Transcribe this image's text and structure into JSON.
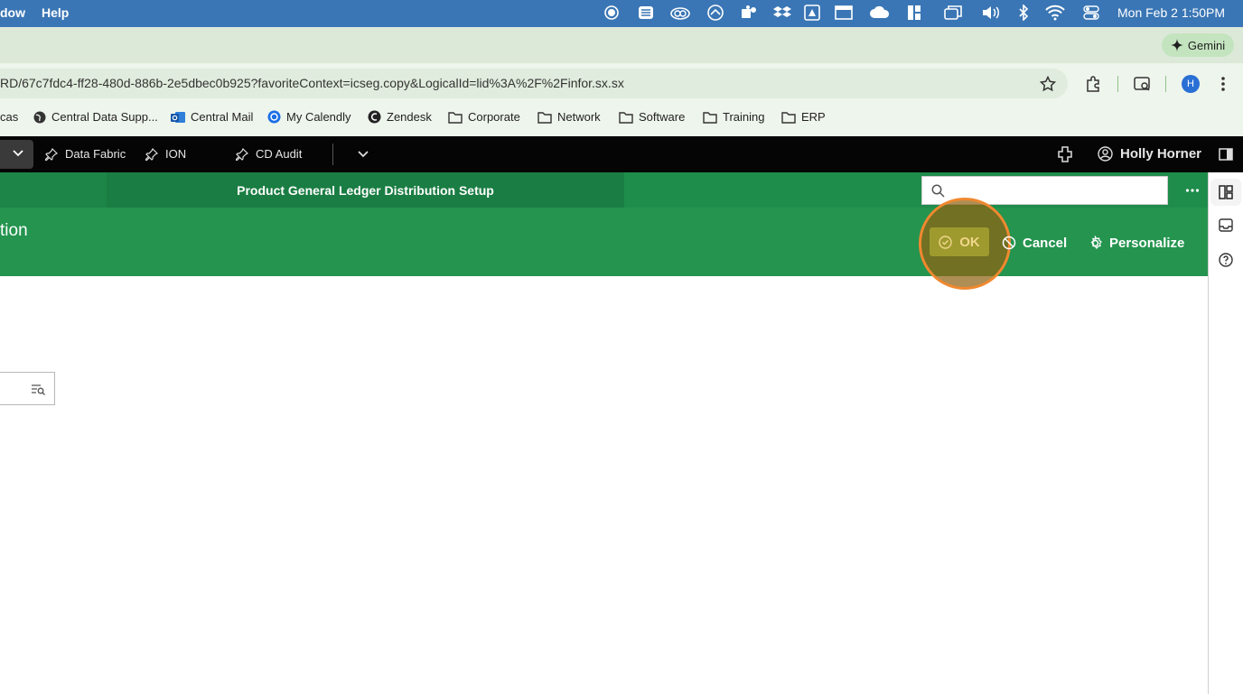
{
  "menubar": {
    "items": [
      "dow",
      "Help"
    ],
    "tray_icons": [
      "record-icon",
      "list-icon",
      "cc-icon",
      "sync-icon",
      "teams-icon",
      "dropbox-icon",
      "drive-icon",
      "window-icon",
      "cloud-icon",
      "panel-icon",
      "screens-icon",
      "volume-icon",
      "bluetooth-icon",
      "wifi-icon",
      "control-center-icon"
    ],
    "clock": "Mon Feb 2  1:50PM"
  },
  "gemini": {
    "label": "Gemini"
  },
  "browser": {
    "url": "RD/67c7fdc4-ff28-480d-886b-2e5dbec0b925?favoriteContext=icseg.copy&LogicalId=lid%3A%2F%2Finfor.sx.sx",
    "profile_initial": "H"
  },
  "bookmarks": [
    {
      "label": "cas",
      "icon": "none"
    },
    {
      "label": "Central Data Supp...",
      "icon": "globe-icon"
    },
    {
      "label": "Central Mail",
      "icon": "outlook-icon"
    },
    {
      "label": "My Calendly",
      "icon": "calendly-icon"
    },
    {
      "label": "Zendesk",
      "icon": "zendesk-icon"
    },
    {
      "label": "Corporate",
      "icon": "folder-icon"
    },
    {
      "label": "Network",
      "icon": "folder-icon"
    },
    {
      "label": "Software",
      "icon": "folder-icon"
    },
    {
      "label": "Training",
      "icon": "folder-icon"
    },
    {
      "label": "ERP",
      "icon": "folder-icon"
    }
  ],
  "appbar": {
    "items": [
      "Data Fabric",
      "ION",
      "CD Audit"
    ],
    "user": "Holly Horner"
  },
  "header": {
    "tab_title": "Product General Ledger Distribution Setup",
    "page_title": "tion",
    "actions": {
      "ok": "OK",
      "cancel": "Cancel",
      "personalize": "Personalize"
    }
  },
  "colors": {
    "menubar": "#3a76b5",
    "header_green": "#24944f",
    "tab_green": "#1a7d43",
    "highlight": "#f0882f"
  }
}
